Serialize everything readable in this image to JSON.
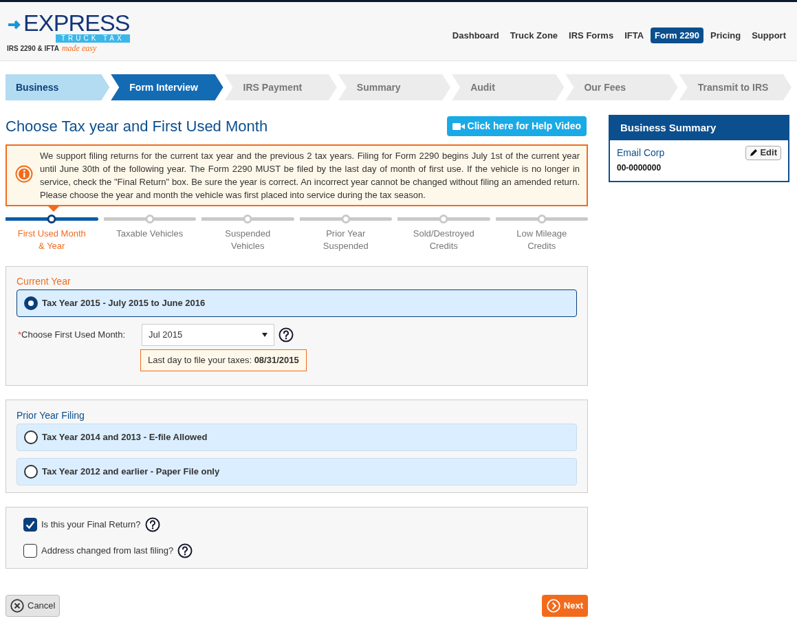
{
  "logo": {
    "wordmark": "EXPRESS",
    "subtitle": "TRUCK TAX",
    "tagline": "IRS 2290 & IFTA",
    "slogan": "made easy"
  },
  "nav": [
    {
      "label": "Dashboard",
      "selected": false
    },
    {
      "label": "Truck Zone",
      "selected": false
    },
    {
      "label": "IRS Forms",
      "selected": false
    },
    {
      "label": "IFTA",
      "selected": false
    },
    {
      "label": "Form 2290",
      "selected": true
    },
    {
      "label": "Pricing",
      "selected": false
    },
    {
      "label": "Support",
      "selected": false
    }
  ],
  "steps": [
    {
      "label": "Business",
      "selected": false,
      "completed": true
    },
    {
      "label": "Form Interview",
      "selected": true,
      "completed": false
    },
    {
      "label": "IRS Payment",
      "selected": false,
      "completed": false
    },
    {
      "label": "Summary",
      "selected": false,
      "completed": false
    },
    {
      "label": "Audit",
      "selected": false,
      "completed": false
    },
    {
      "label": "Our Fees",
      "selected": false,
      "completed": false
    },
    {
      "label": "Transmit to IRS",
      "selected": false,
      "completed": false
    }
  ],
  "page_title": "Choose Tax year and First Used Month",
  "help_button": "Click here for Help Video",
  "info": "We support filing returns for the current tax year and the previous 2 tax years. Filing for Form 2290 begins July 1st of the current year until June 30th of the following year. The Form 2290 MUST be filed by the last day of month of first use. If the vehicle is no longer in service, check the \"Final Return\" box. Be sure the year is correct. An incorrect year cannot be changed without filing an amended return. Please choose the year and month the vehicle was first placed into service during the tax season.",
  "substeps": [
    {
      "label": "First Used Month & Year",
      "selected": true
    },
    {
      "label": "Taxable Vehicles",
      "selected": false
    },
    {
      "label": "Suspended Vehicles",
      "selected": false
    },
    {
      "label": "Prior Year Suspended",
      "selected": false
    },
    {
      "label": "Sold/Destroyed Credits",
      "selected": false
    },
    {
      "label": "Low Mileage Credits",
      "selected": false
    }
  ],
  "current_year": {
    "heading": "Current Year",
    "option": {
      "label": "Tax Year 2015 - July 2015 to June 2016",
      "selected": true
    },
    "month_label": "Choose First Used Month:",
    "required_mark": "*",
    "month_value": "Jul 2015",
    "deadline_label": "Last day to file your taxes: **08/31/2015**"
  },
  "prior_year": {
    "heading": "Prior Year Filing",
    "options": [
      {
        "label": "Tax Year 2014 and 2013 - E-file Allowed",
        "selected": false
      },
      {
        "label": "Tax Year 2012 and earlier - Paper File only",
        "selected": false
      }
    ]
  },
  "checkboxes": [
    {
      "label": "Is this your Final Return?",
      "checked": true
    },
    {
      "label": "Address changed from last filing?",
      "checked": false
    }
  ],
  "cancel": "Cancel",
  "next": "Next",
  "business_summary": {
    "title": "Business Summary",
    "name": "Email Corp",
    "ein": "00-0000000",
    "edit": "Edit"
  }
}
